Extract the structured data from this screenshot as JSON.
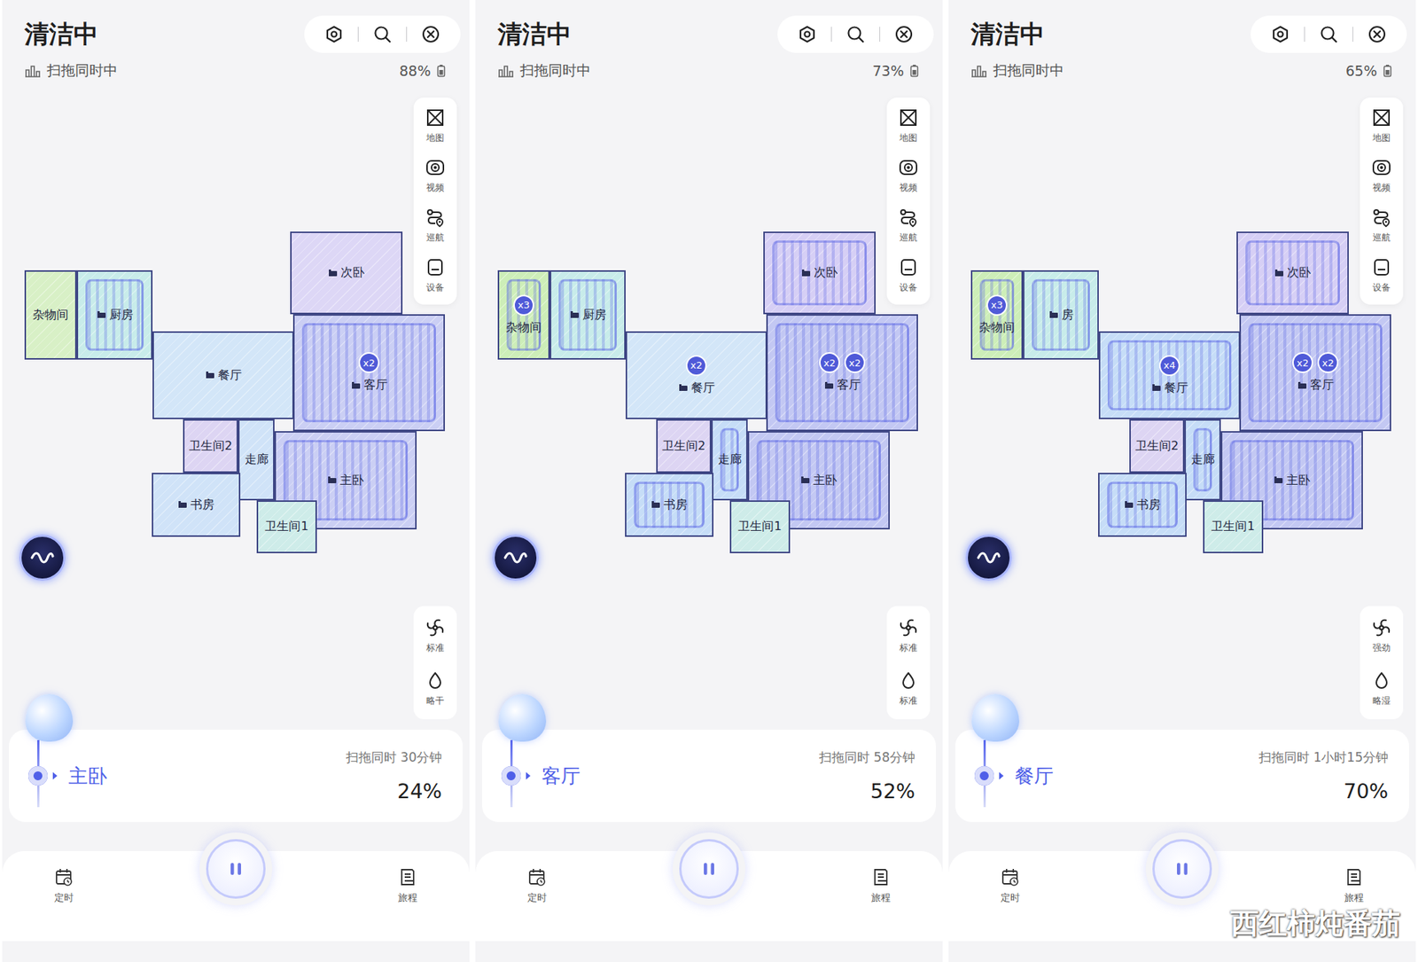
{
  "panels": [
    {
      "title": "清洁中",
      "mode_label": "扫拖同时中",
      "battery": "88%",
      "tools": [
        {
          "label": "地图"
        },
        {
          "label": "视频"
        },
        {
          "label": "巡航"
        },
        {
          "label": "设备"
        }
      ],
      "settings": [
        {
          "label": "标准",
          "kind": "suction"
        },
        {
          "label": "略干",
          "kind": "water"
        }
      ],
      "rooms": [
        {
          "name": "杂物间",
          "color": "#d8f0c6",
          "cleaned": false,
          "badges": []
        },
        {
          "name": "厨房",
          "color": "#c8ecea",
          "cleaned": true,
          "badges": []
        },
        {
          "name": "次卧",
          "color": "#ddd7f6",
          "cleaned": false,
          "badges": []
        },
        {
          "name": "餐厅",
          "color": "#d3e6f8",
          "cleaned": false,
          "badges": []
        },
        {
          "name": "客厅",
          "color": "#cbcff4",
          "cleaned": true,
          "badges": [
            "x2"
          ]
        },
        {
          "name": "卫生间2",
          "color": "#ddd5f3",
          "cleaned": false,
          "badges": []
        },
        {
          "name": "走廊",
          "color": "#d0e3f8",
          "cleaned": false,
          "badges": []
        },
        {
          "name": "主卧",
          "color": "#cbcff4",
          "cleaned": true,
          "badges": []
        },
        {
          "name": "书房",
          "color": "#d0e3f8",
          "cleaned": false,
          "badges": []
        },
        {
          "name": "卫生间1",
          "color": "#ceece9",
          "cleaned": false,
          "badges": []
        }
      ],
      "status": {
        "room": "主卧",
        "task": "扫拖同时 30分钟",
        "progress": "24%"
      },
      "nav": [
        {
          "label": "定时"
        },
        {
          "label": "旅程"
        }
      ]
    },
    {
      "title": "清洁中",
      "mode_label": "扫拖同时中",
      "battery": "73%",
      "tools": [
        {
          "label": "地图"
        },
        {
          "label": "视频"
        },
        {
          "label": "巡航"
        },
        {
          "label": "设备"
        }
      ],
      "settings": [
        {
          "label": "标准",
          "kind": "suction"
        },
        {
          "label": "标准",
          "kind": "water"
        }
      ],
      "rooms": [
        {
          "name": "杂物间",
          "color": "#cdeeb8",
          "cleaned": true,
          "badges": [
            "x3"
          ]
        },
        {
          "name": "厨房",
          "color": "#c8ecea",
          "cleaned": true,
          "badges": []
        },
        {
          "name": "次卧",
          "color": "#d6cff5",
          "cleaned": true,
          "badges": []
        },
        {
          "name": "餐厅",
          "color": "#d3e6f8",
          "cleaned": false,
          "badges": [
            "x2"
          ]
        },
        {
          "name": "客厅",
          "color": "#c3c8f3",
          "cleaned": true,
          "badges": [
            "x2",
            "x2"
          ]
        },
        {
          "name": "卫生间2",
          "color": "#ddd5f3",
          "cleaned": false,
          "badges": []
        },
        {
          "name": "走廊",
          "color": "#c6ddf7",
          "cleaned": true,
          "badges": []
        },
        {
          "name": "主卧",
          "color": "#c3c8f3",
          "cleaned": true,
          "badges": []
        },
        {
          "name": "书房",
          "color": "#c6ddf7",
          "cleaned": true,
          "badges": []
        },
        {
          "name": "卫生间1",
          "color": "#ceece9",
          "cleaned": false,
          "badges": []
        }
      ],
      "status": {
        "room": "客厅",
        "task": "扫拖同时 58分钟",
        "progress": "52%"
      },
      "nav": [
        {
          "label": "定时"
        },
        {
          "label": "旅程"
        }
      ]
    },
    {
      "title": "清洁中",
      "mode_label": "扫拖同时中",
      "battery": "65%",
      "tools": [
        {
          "label": "地图"
        },
        {
          "label": "视频"
        },
        {
          "label": "巡航"
        },
        {
          "label": "设备"
        }
      ],
      "settings": [
        {
          "label": "强劲",
          "kind": "suction"
        },
        {
          "label": "略湿",
          "kind": "water"
        }
      ],
      "rooms": [
        {
          "name": "杂物间",
          "color": "#cdeeb8",
          "cleaned": true,
          "badges": [
            "x3"
          ]
        },
        {
          "name": "房",
          "color": "#c8ecea",
          "cleaned": true,
          "badges": []
        },
        {
          "name": "次卧",
          "color": "#d6cff5",
          "cleaned": true,
          "badges": []
        },
        {
          "name": "餐厅",
          "color": "#c6ddf7",
          "cleaned": true,
          "badges": [
            "x4"
          ]
        },
        {
          "name": "客厅",
          "color": "#c3c8f3",
          "cleaned": true,
          "badges": [
            "x2",
            "x2"
          ]
        },
        {
          "name": "卫生间2",
          "color": "#ddd5f3",
          "cleaned": false,
          "badges": []
        },
        {
          "name": "走廊",
          "color": "#c6ddf7",
          "cleaned": true,
          "badges": []
        },
        {
          "name": "主卧",
          "color": "#c3c8f3",
          "cleaned": true,
          "badges": []
        },
        {
          "name": "书房",
          "color": "#c6ddf7",
          "cleaned": true,
          "badges": []
        },
        {
          "name": "卫生间1",
          "color": "#ceece9",
          "cleaned": false,
          "badges": []
        }
      ],
      "status": {
        "room": "餐厅",
        "task": "扫拖同时 1小时15分钟",
        "progress": "70%"
      },
      "nav": [
        {
          "label": "定时"
        },
        {
          "label": "旅程"
        }
      ]
    }
  ],
  "watermark": "西红柿炖番茄"
}
